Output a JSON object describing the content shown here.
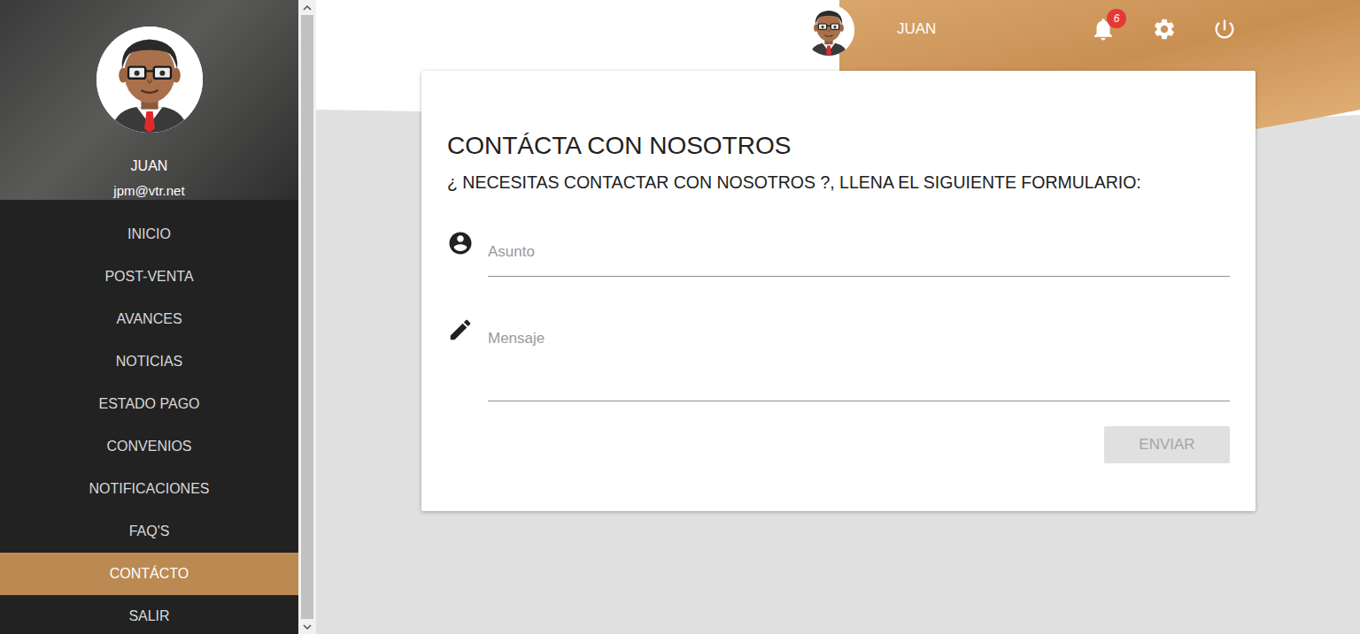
{
  "sidebar": {
    "user": {
      "name": "JUAN",
      "email": "jpm@vtr.net"
    },
    "items": [
      {
        "label": "INICIO",
        "selected": false
      },
      {
        "label": "POST-VENTA",
        "selected": false
      },
      {
        "label": "AVANCES",
        "selected": false
      },
      {
        "label": "NOTICIAS",
        "selected": false
      },
      {
        "label": "ESTADO PAGO",
        "selected": false
      },
      {
        "label": "CONVENIOS",
        "selected": false
      },
      {
        "label": "NOTIFICACIONES",
        "selected": false
      },
      {
        "label": "FAQ'S",
        "selected": false
      },
      {
        "label": "CONTÁCTO",
        "selected": true
      },
      {
        "label": "SALIR",
        "selected": false
      }
    ]
  },
  "topbar": {
    "user_name": "JUAN",
    "notifications": "6"
  },
  "form": {
    "title": "CONTÁCTA CON NOSOTROS",
    "subtitle": "¿ NECESITAS CONTACTAR CON NOSOTROS ?, LLENA EL SIGUIENTE FORMULARIO:",
    "fields": [
      {
        "placeholder": "Asunto",
        "kind": "input"
      },
      {
        "placeholder": "Mensaje",
        "kind": "textarea"
      }
    ],
    "submit": {
      "label": "ENVIAR",
      "disabled": true
    }
  }
}
